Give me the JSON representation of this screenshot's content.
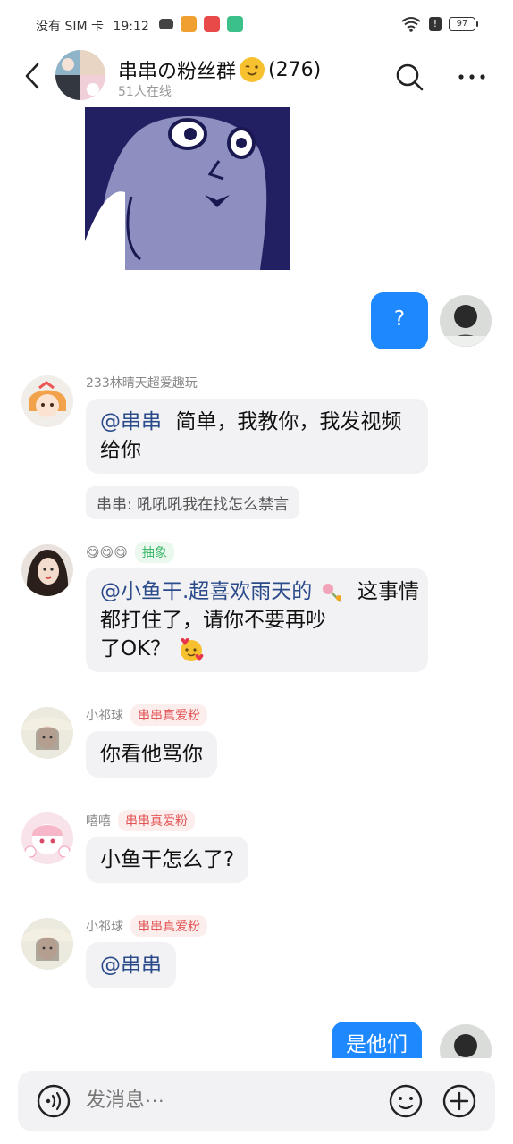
{
  "status_bar": {
    "carrier": "没有 SIM 卡",
    "time": "19:12",
    "network": "6",
    "battery": "97"
  },
  "header": {
    "group_name": "串串の粉丝群",
    "member_count": "(276)",
    "online": "51人在线"
  },
  "messages": [
    {
      "id": "m1",
      "type": "sticker",
      "side": "left"
    },
    {
      "id": "m2",
      "side": "right",
      "text": "?"
    },
    {
      "id": "m3",
      "side": "left",
      "sender": "233林晴天超爱趣玩",
      "mention": "@串串",
      "text": "简单，我教你，我发视频给你",
      "reply_quote": "串串: 吼吼吼我在找怎么禁言"
    },
    {
      "id": "m4",
      "side": "left",
      "sender_emoji": "😋😋😋",
      "tag": "抽象",
      "mention": "@小鱼干.超喜欢雨天的",
      "text_a": "这事情都打住了，请你不要再吵",
      "text_b": "了OK？"
    },
    {
      "id": "m5",
      "side": "left",
      "sender": "小祁球",
      "tag": "串串真爱粉",
      "text": "你看他骂你"
    },
    {
      "id": "m6",
      "side": "left",
      "sender": "嘻嘻",
      "tag": "串串真爱粉",
      "text": "小鱼干怎么了?"
    },
    {
      "id": "m7",
      "side": "left",
      "sender": "小祁球",
      "tag": "串串真爱粉",
      "mention": "@串串"
    },
    {
      "id": "m8",
      "side": "right",
      "text": "是他们"
    }
  ],
  "input": {
    "placeholder": "发消息···"
  },
  "icons": {
    "back": "chevron-left-icon",
    "search": "search-icon",
    "more": "more-icon",
    "voice": "voice-icon",
    "emoji": "emoji-icon",
    "add": "plus-icon"
  },
  "colors": {
    "blue_bubble": "#1e88ff",
    "tag_red": "#e25454",
    "tag_green": "#3cb96a"
  }
}
